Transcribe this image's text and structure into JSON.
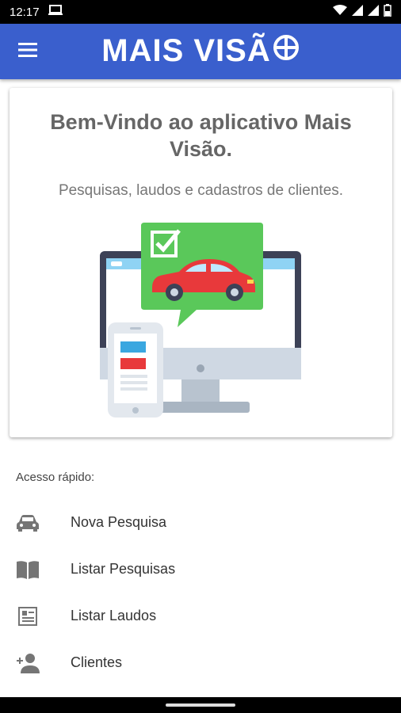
{
  "status_bar": {
    "time": "12:17",
    "icons": [
      "laptop-icon",
      "wifi-icon",
      "signal-icon",
      "signal-icon",
      "battery-icon"
    ]
  },
  "app_bar": {
    "brand": "MAIS VISÃ",
    "brand_symbol_icon": "crosshair-circle-icon",
    "menu_icon": "hamburger-icon",
    "color": "#3a5fcd"
  },
  "welcome_card": {
    "title": "Bem-Vindo ao aplicativo Mais Visão.",
    "subtitle": "Pesquisas, laudos e cadastros de clientes.",
    "illustration_icon": "monitor-car-check-illustration"
  },
  "quick_access": {
    "label": "Acesso rápido:",
    "items": [
      {
        "label": "Nova Pesquisa",
        "icon": "car-icon"
      },
      {
        "label": "Listar Pesquisas",
        "icon": "book-icon"
      },
      {
        "label": "Listar Laudos",
        "icon": "document-list-icon"
      },
      {
        "label": "Clientes",
        "icon": "person-add-icon"
      }
    ]
  }
}
